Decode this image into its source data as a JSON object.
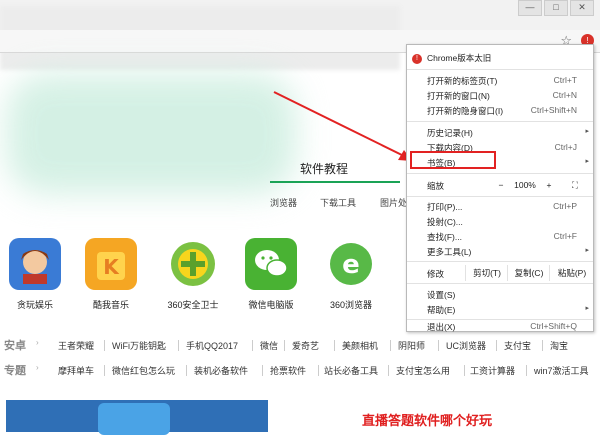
{
  "window": {
    "min_label": "—",
    "max_label": "□",
    "close_label": "✕"
  },
  "toolbar": {
    "star_icon": "☆",
    "menu_icon": "!"
  },
  "page": {
    "section_title": "软件教程",
    "subtabs": [
      "浏览器",
      "下载工具",
      "图片处"
    ],
    "apps": [
      {
        "label": "贪玩娱乐",
        "icon": "game-avatar-icon",
        "color": "#3a7bd5"
      },
      {
        "label": "酷我音乐",
        "icon": "music-k-icon",
        "color": "#f5a623"
      },
      {
        "label": "360安全卫士",
        "icon": "shield-360-icon",
        "color": "#7bc142"
      },
      {
        "label": "微信电脑版",
        "icon": "wechat-icon",
        "color": "#49b233"
      },
      {
        "label": "360浏览器",
        "icon": "browser-360-icon",
        "color": "#58b947"
      }
    ],
    "rows": [
      {
        "head": "安卓",
        "items": [
          "王者荣耀",
          "WiFi万能钥匙",
          "手机QQ2017",
          "微信",
          "爱奇艺",
          "美颜相机",
          "阴阳师",
          "UC浏览器",
          "支付宝",
          "淘宝"
        ]
      },
      {
        "head": "专题",
        "items": [
          "摩拜单车",
          "微信红包怎么玩",
          "装机必备软件",
          "抢票软件",
          "站长必备工具",
          "支付宝怎么用",
          "工资计算器",
          "win7激活工具"
        ]
      }
    ],
    "promo": "直播答题软件哪个好玩"
  },
  "menu": {
    "update_notice": "Chrome版本太旧",
    "new_tab": {
      "label": "打开新的标签页(T)",
      "shortcut": "Ctrl+T"
    },
    "new_window": {
      "label": "打开新的窗口(N)",
      "shortcut": "Ctrl+N"
    },
    "incognito": {
      "label": "打开新的隐身窗口(I)",
      "shortcut": "Ctrl+Shift+N"
    },
    "history": {
      "label": "历史记录(H)"
    },
    "downloads": {
      "label": "下载内容(D)",
      "shortcut": "Ctrl+J"
    },
    "bookmarks": {
      "label": "书签(B)"
    },
    "zoom": {
      "label": "缩放",
      "minus": "−",
      "value": "100%",
      "plus": "+",
      "fullscreen": "⛶"
    },
    "print": {
      "label": "打印(P)...",
      "shortcut": "Ctrl+P"
    },
    "cast": {
      "label": "投射(C)..."
    },
    "find": {
      "label": "查找(F)...",
      "shortcut": "Ctrl+F"
    },
    "more_tools": {
      "label": "更多工具(L)"
    },
    "edit": {
      "label": "修改",
      "cut": "剪切(T)",
      "copy": "复制(C)",
      "paste": "粘贴(P)"
    },
    "settings": {
      "label": "设置(S)"
    },
    "help": {
      "label": "帮助(E)"
    },
    "exit": {
      "label": "退出(X)",
      "shortcut": "Ctrl+Shift+Q"
    },
    "submenu_arrow": "▸"
  },
  "annotation": {
    "arrow_color": "#e22222"
  }
}
